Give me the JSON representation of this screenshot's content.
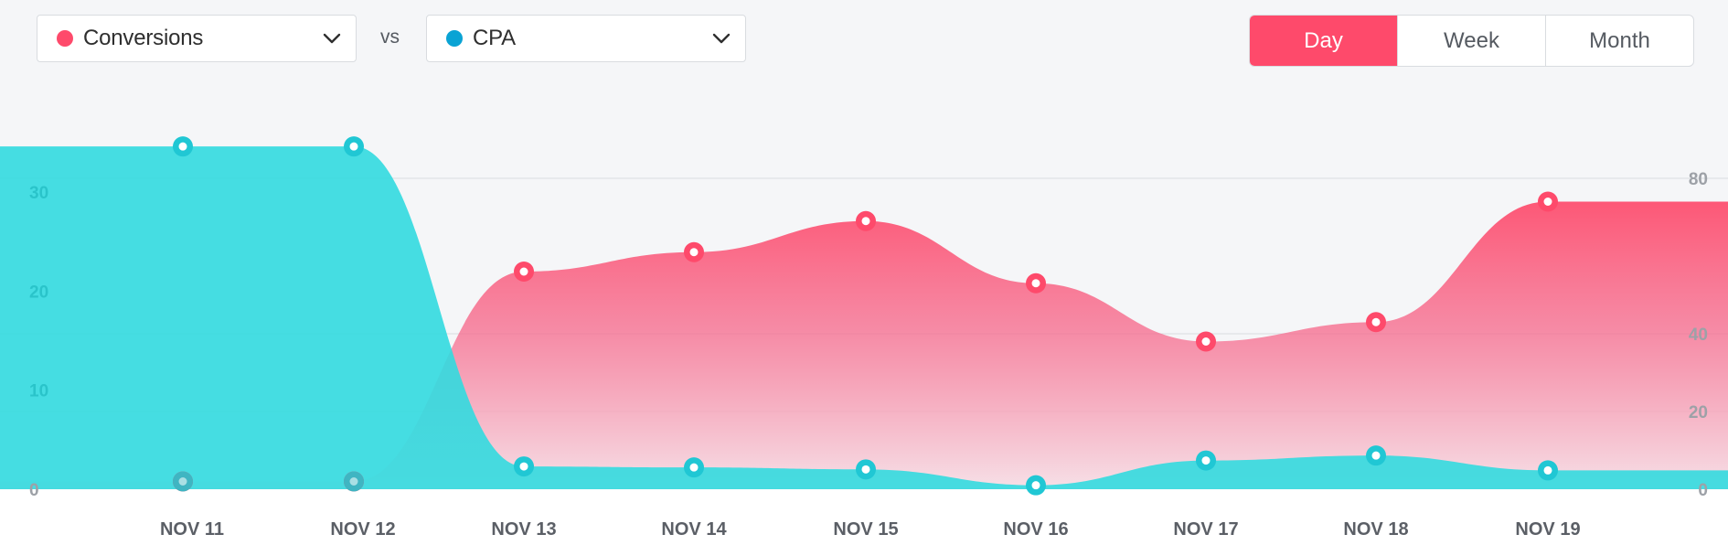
{
  "controls": {
    "primary_metric": {
      "label": "Conversions",
      "color": "#fe4a6b",
      "icon": "chevron-down-icon"
    },
    "vs_label": "vs",
    "secondary_metric": {
      "label": "CPA",
      "color": "#0aa3d4",
      "icon": "chevron-down-icon"
    },
    "periods": [
      {
        "label": "Day",
        "active": true
      },
      {
        "label": "Week",
        "active": false
      },
      {
        "label": "Month",
        "active": false
      }
    ]
  },
  "colors": {
    "conversions": "#fe4a6b",
    "cpa": "#32dadf",
    "cpa_marker": "#20c7d4",
    "gridline": "#dfe1e5",
    "right_tick_text": "#9da1a7",
    "left_tick_text": "#2ac4ca",
    "x_tick_text": "#5b5f66"
  },
  "chart_data": {
    "type": "area",
    "x": [
      "NOV 11",
      "NOV 12",
      "NOV 13",
      "NOV 14",
      "NOV 15",
      "NOV 16",
      "NOV 17",
      "NOV 18",
      "NOV 19"
    ],
    "axes": {
      "left": {
        "ticks": [
          0,
          10,
          20,
          30
        ],
        "range": [
          0,
          30
        ]
      },
      "right": {
        "ticks": [
          0,
          20,
          40,
          80
        ],
        "range": [
          0,
          80
        ]
      }
    },
    "grid": true,
    "series": [
      {
        "name": "Conversions",
        "axis": "right",
        "values": [
          2,
          2,
          56,
          61,
          69,
          53,
          38,
          43,
          74
        ]
      },
      {
        "name": "CPA",
        "axis": "left",
        "values": [
          34.6,
          34.6,
          2.3,
          2.2,
          2.0,
          0.4,
          2.9,
          3.4,
          1.9
        ]
      }
    ]
  }
}
